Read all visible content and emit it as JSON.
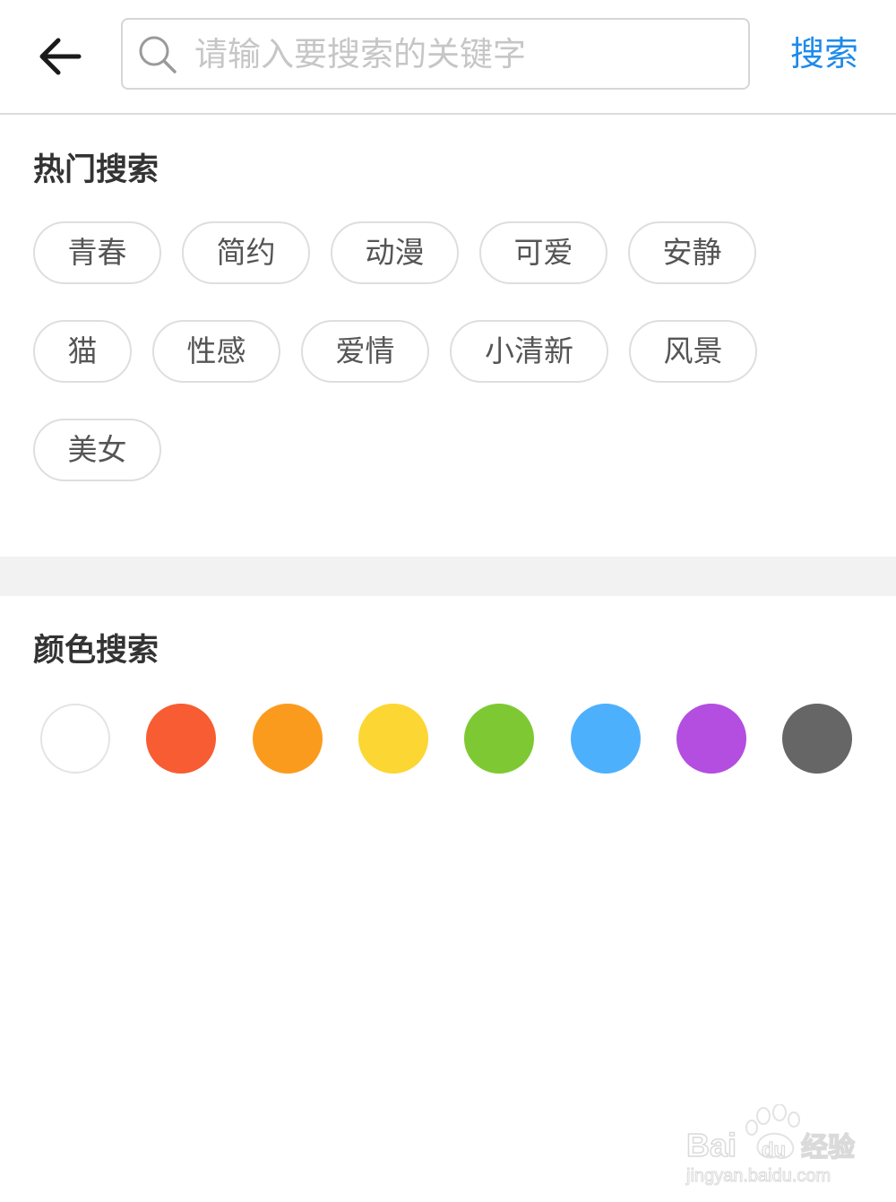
{
  "header": {
    "back_icon": "arrow-left-icon",
    "search": {
      "icon": "search-icon",
      "placeholder": "请输入要搜索的关键字",
      "value": ""
    },
    "search_button_label": "搜索"
  },
  "hot_search": {
    "title": "热门搜索",
    "rows": [
      [
        "青春",
        "简约",
        "动漫",
        "可爱",
        "安静"
      ],
      [
        "猫",
        "性感",
        "爱情",
        "小清新",
        "风景"
      ],
      [
        "美女"
      ]
    ]
  },
  "color_search": {
    "title": "颜色搜索",
    "swatches": [
      {
        "name": "white",
        "color": "#ffffff"
      },
      {
        "name": "red",
        "color": "#f75c32"
      },
      {
        "name": "orange",
        "color": "#fb9b1e"
      },
      {
        "name": "yellow",
        "color": "#fcd632"
      },
      {
        "name": "green",
        "color": "#7ec933"
      },
      {
        "name": "blue",
        "color": "#4db0fc"
      },
      {
        "name": "purple",
        "color": "#b34ee0"
      },
      {
        "name": "gray",
        "color": "#666666"
      }
    ]
  },
  "watermark": {
    "text": "Baidu经验",
    "url_text": "jingyan.baidu.com"
  },
  "colors": {
    "accent": "#1e8bea",
    "placeholder": "#c6c6c6",
    "tag_border": "#dedede",
    "divider_band": "#f2f2f2"
  }
}
